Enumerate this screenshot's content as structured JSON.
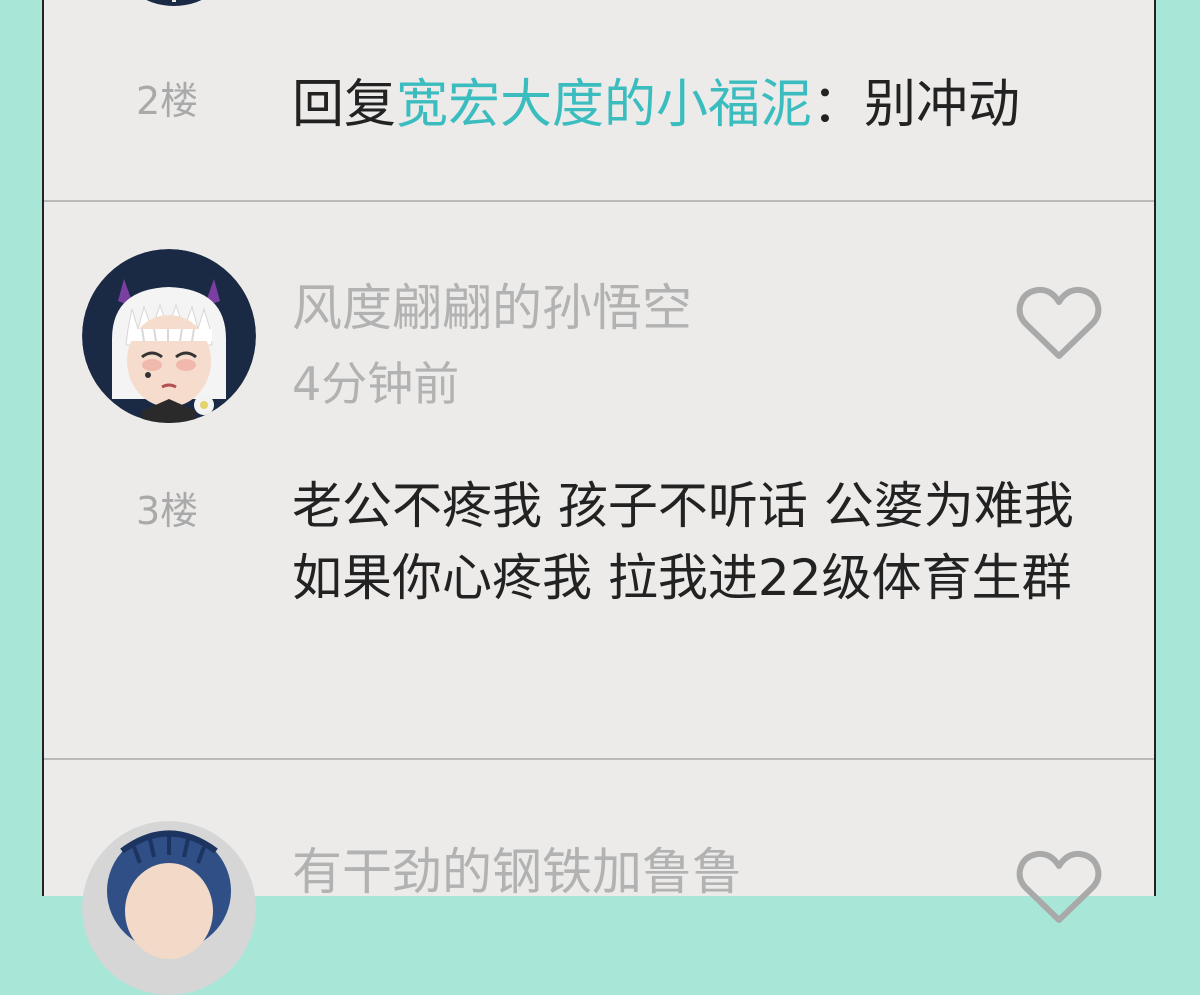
{
  "replies": [
    {
      "floor": "2楼",
      "prefix": "回复",
      "mention": "宽宏大度的小福泥",
      "suffix": "：别冲动"
    }
  ],
  "comments": [
    {
      "username": "风度翩翩的孙悟空",
      "time": "4分钟前",
      "floor": "3楼",
      "text": "老公不疼我 孩子不听话 公婆为难我 如果你心疼我 拉我进22级体育生群",
      "avatar_icon": "avatar-horned-girl-icon"
    },
    {
      "username": "有干劲的钢铁加鲁鲁",
      "avatar_icon": "avatar-blue-hair-icon"
    }
  ],
  "colors": {
    "background": "#a8e6d8",
    "panel": "#ecebea",
    "mention": "#3bbdbf",
    "muted": "#b2b2b2",
    "text": "#222222"
  }
}
